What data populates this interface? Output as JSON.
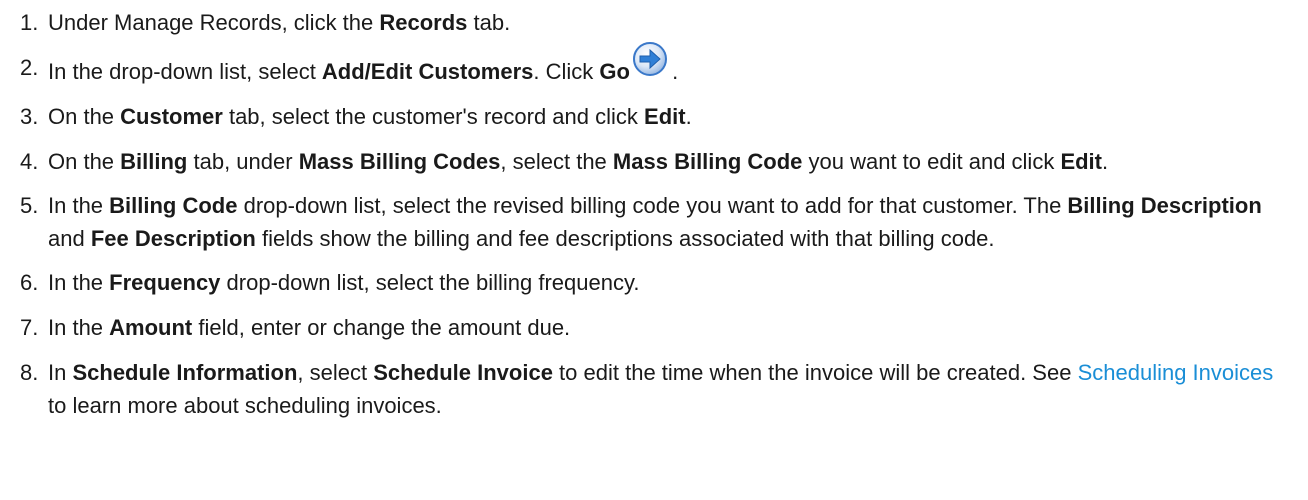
{
  "steps": [
    {
      "num": "1.",
      "parts": [
        "Under Manage Records, click the ",
        "Records",
        " tab."
      ]
    },
    {
      "num": "2.",
      "parts": [
        "In the drop-down list, select ",
        "Add/Edit Customers",
        ". Click ",
        "Go",
        " ."
      ],
      "icon": "go-arrow-icon"
    },
    {
      "num": "3.",
      "parts": [
        "On the ",
        "Customer",
        " tab, select the customer's record and click ",
        "Edit",
        "."
      ]
    },
    {
      "num": "4.",
      "parts": [
        "On the ",
        "Billing",
        " tab, under ",
        "Mass Billing Codes",
        ", select the ",
        "Mass Billing Code",
        " you want to edit and click ",
        "Edit",
        "."
      ]
    },
    {
      "num": "5.",
      "parts": [
        "In the ",
        "Billing Code",
        " drop-down list, select the revised billing code you want to add for that customer. The ",
        "Billing Description",
        " and ",
        "Fee Description",
        " fields show the billing and fee descriptions associated with that billing code."
      ]
    },
    {
      "num": "6.",
      "parts": [
        "In the ",
        "Frequency",
        " drop-down list, select the billing frequency."
      ]
    },
    {
      "num": "7.",
      "parts": [
        "In the ",
        "Amount",
        " field, enter or change the amount due."
      ]
    },
    {
      "num": "8.",
      "parts": [
        "In ",
        "Schedule Information",
        ", select ",
        "Schedule Invoice",
        " to edit the time when the invoice will be created. See ",
        "Scheduling Invoices",
        " to learn more about scheduling invoices."
      ]
    }
  ],
  "colors": {
    "text": "#1a1a1a",
    "link": "#1a8ed6",
    "icon_blue": "#2f7fd6"
  }
}
